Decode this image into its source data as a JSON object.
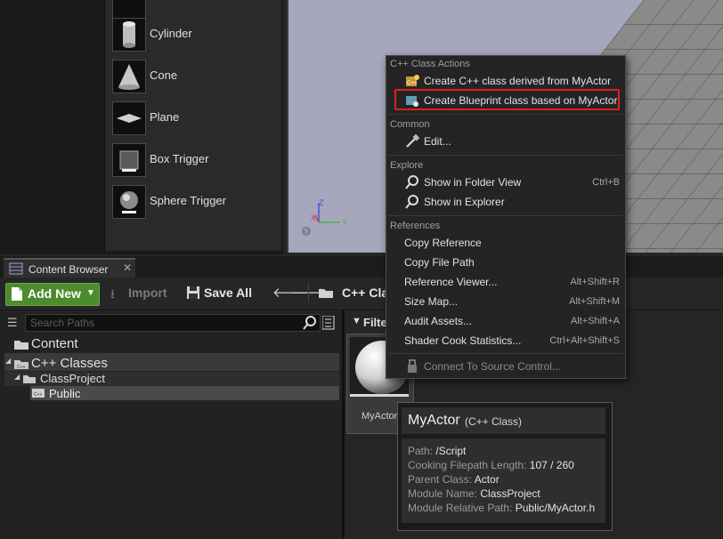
{
  "place_actors": {
    "items": [
      {
        "label": "Cylinder"
      },
      {
        "label": "Cone"
      },
      {
        "label": "Plane"
      },
      {
        "label": "Box Trigger"
      },
      {
        "label": "Sphere Trigger"
      }
    ]
  },
  "viewport": {
    "axis_z": "Z",
    "axis_x": "X",
    "axis_y": "Y"
  },
  "content_browser": {
    "tab_label": "Content Browser",
    "toolbar": {
      "add_new": "Add New",
      "import": "Import",
      "save_all": "Save All",
      "path_label": "C++ Cla"
    },
    "search_placeholder": "Search Paths",
    "tree": [
      {
        "label": "Content"
      },
      {
        "label": "C++ Classes"
      },
      {
        "label": "ClassProject"
      },
      {
        "label": "Public"
      }
    ],
    "filters_label": "Filter",
    "asset": {
      "name": "MyActor"
    }
  },
  "context_menu": {
    "sections": [
      {
        "header": "C++ Class Actions",
        "items": [
          {
            "label": "Create C++ class derived from MyActor",
            "shortcut": ""
          },
          {
            "label": "Create Blueprint class based on MyActor",
            "shortcut": ""
          }
        ]
      },
      {
        "header": "Common",
        "items": [
          {
            "label": "Edit...",
            "shortcut": ""
          }
        ]
      },
      {
        "header": "Explore",
        "items": [
          {
            "label": "Show in Folder View",
            "shortcut": "Ctrl+B"
          },
          {
            "label": "Show in Explorer",
            "shortcut": ""
          }
        ]
      },
      {
        "header": "References",
        "items": [
          {
            "label": "Copy Reference",
            "shortcut": ""
          },
          {
            "label": "Copy File Path",
            "shortcut": ""
          },
          {
            "label": "Reference Viewer...",
            "shortcut": "Alt+Shift+R"
          },
          {
            "label": "Size Map...",
            "shortcut": "Alt+Shift+M"
          },
          {
            "label": "Audit Assets...",
            "shortcut": "Alt+Shift+A"
          },
          {
            "label": "Shader Cook Statistics...",
            "shortcut": "Ctrl+Alt+Shift+S"
          }
        ]
      }
    ],
    "source_control": "Connect To Source Control..."
  },
  "tooltip": {
    "title": "MyActor",
    "subtitle": "(C++ Class)",
    "rows": [
      {
        "key": "Path:",
        "value": "/Script"
      },
      {
        "key": "Cooking Filepath Length:",
        "value": "107 / 260"
      },
      {
        "key": "Parent Class:",
        "value": "Actor"
      },
      {
        "key": "Module Name:",
        "value": "ClassProject"
      },
      {
        "key": "Module Relative Path:",
        "value": "Public/MyActor.h"
      }
    ]
  },
  "colors": {
    "accent_green": "#4d8b2f",
    "highlight_red": "#e02020",
    "menu_bg": "#242424"
  }
}
